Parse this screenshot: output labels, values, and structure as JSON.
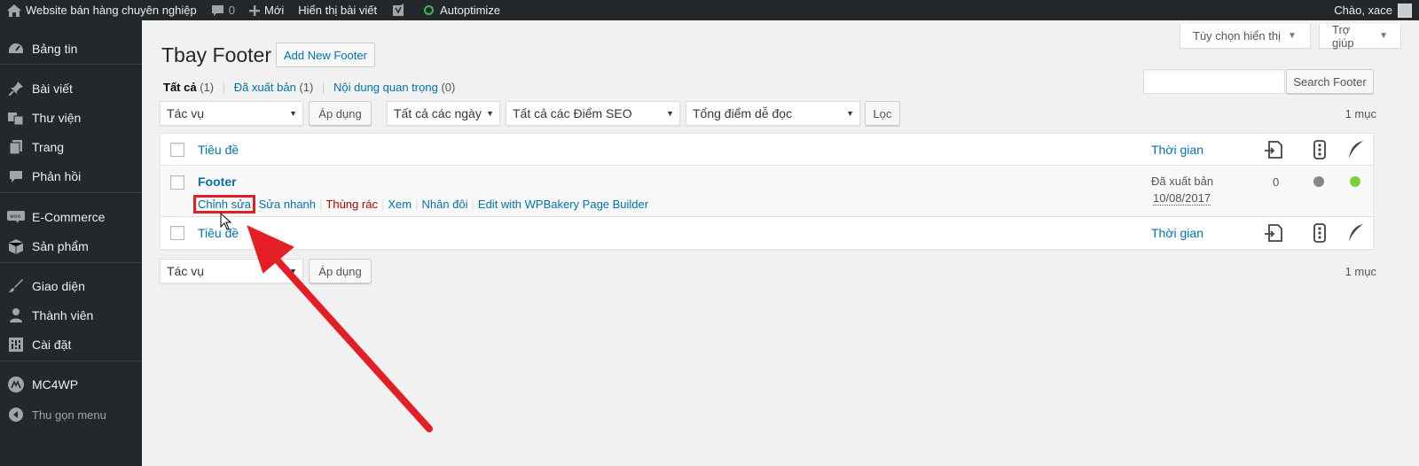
{
  "colors": {
    "admin_bar": "#23282d",
    "link": "#0073aa",
    "trash": "#aa0000",
    "annotation_red": "#e31e24",
    "status_grey": "#888888",
    "status_green": "#7ad03a"
  },
  "admin_bar": {
    "site_name": "Website bán hàng chuyên nghiệp",
    "comments_count": "0",
    "new_label": "Mới",
    "show_posts": "Hiển thị bài viết",
    "yoast_icon": "yoast-icon",
    "autoptimize": "Autoptimize",
    "greeting": "Chào, xace"
  },
  "sidebar": {
    "items": [
      {
        "label": "Bảng tin",
        "icon": "dashboard-icon"
      },
      {
        "label": "Bài viết",
        "icon": "pin-icon"
      },
      {
        "label": "Thư viện",
        "icon": "media-icon"
      },
      {
        "label": "Trang",
        "icon": "page-icon"
      },
      {
        "label": "Phản hồi",
        "icon": "comment-icon"
      },
      {
        "label": "E-Commerce",
        "icon": "woo-icon"
      },
      {
        "label": "Sản phẩm",
        "icon": "product-icon"
      },
      {
        "label": "Giao diện",
        "icon": "brush-icon"
      },
      {
        "label": "Thành viên",
        "icon": "user-icon"
      },
      {
        "label": "Cài đặt",
        "icon": "settings-icon"
      },
      {
        "label": "MC4WP",
        "icon": "mc4wp-icon"
      }
    ],
    "collapse": "Thu gọn menu"
  },
  "header": {
    "screen_options": "Tùy chọn hiển thị",
    "help": "Trợ giúp",
    "title": "Tbay Footer",
    "add_new": "Add New Footer"
  },
  "filters": {
    "all": "Tất cả",
    "all_count": "(1)",
    "published": "Đã xuất bản",
    "published_count": "(1)",
    "cornerstone": "Nội dung quan trọng",
    "cornerstone_count": "(0)",
    "separator": "|"
  },
  "search": {
    "value": "",
    "button": "Search Footer"
  },
  "tablenav_top": {
    "bulk_action": "Tác vụ",
    "apply": "Áp dụng",
    "dates": "Tất cả các ngày",
    "seo": "Tất cả các Điểm SEO",
    "readability": "Tổng điểm dễ đọc",
    "filter": "Lọc",
    "count": "1 mục"
  },
  "table": {
    "col_title": "Tiêu đề",
    "col_date": "Thời gian",
    "col_icons": [
      "links-icon",
      "traffic-light-icon",
      "feather-icon"
    ],
    "rows": [
      {
        "title": "Footer",
        "actions": {
          "edit": "Chỉnh sửa",
          "quick_edit": "Sửa nhanh",
          "trash": "Thùng rác",
          "view": "Xem",
          "duplicate": "Nhân đôi",
          "wpbakery": "Edit with WPBakery Page Builder"
        },
        "status": "Đã xuất bản",
        "date": "10/08/2017",
        "links": "0",
        "seo_status": "grey",
        "readability_status": "green"
      }
    ]
  },
  "tablenav_bottom": {
    "bulk_action": "Tác vụ",
    "apply": "Áp dụng",
    "count": "1 mục"
  }
}
